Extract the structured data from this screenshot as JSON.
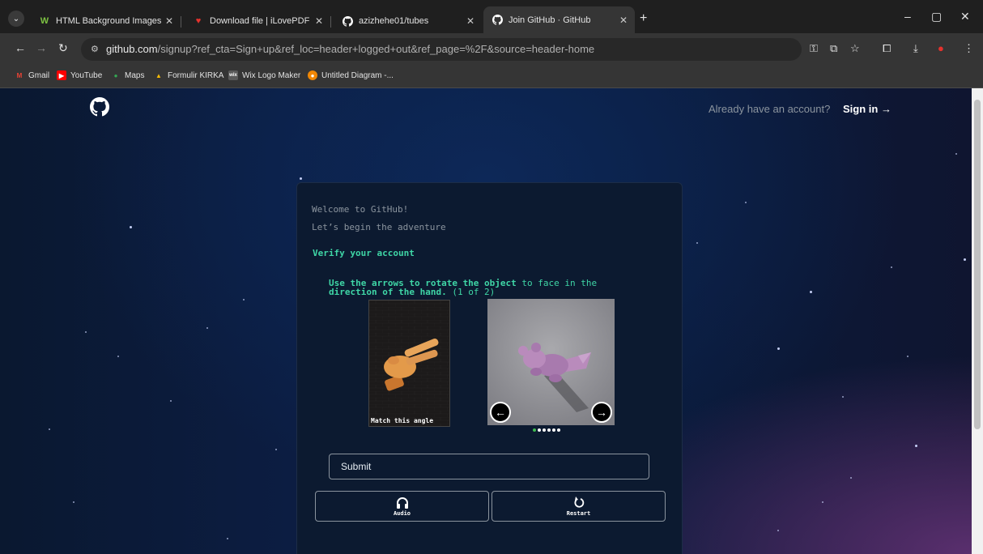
{
  "browser": {
    "tabs": [
      {
        "title": "HTML Background Images",
        "favicon": "W",
        "favicon_color": "#7dc242"
      },
      {
        "title": "Download file | iLovePDF",
        "favicon": "♥",
        "favicon_color": "#e5322d"
      },
      {
        "title": "azizhehe01/tubes",
        "favicon": "github",
        "favicon_color": "#ffffff"
      },
      {
        "title": "Join GitHub · GitHub",
        "favicon": "github",
        "favicon_color": "#ffffff",
        "active": true
      }
    ],
    "url_host": "github.com",
    "url_rest": "/signup?ref_cta=Sign+up&ref_loc=header+logged+out&ref_page=%2F&source=header-home",
    "bookmarks": [
      {
        "label": "Gmail",
        "icon": "M",
        "color": "#ea4335"
      },
      {
        "label": "YouTube",
        "icon": "▶",
        "color": "#ff0000"
      },
      {
        "label": "Maps",
        "icon": "●",
        "color": "#34a853"
      },
      {
        "label": "Formulir KIRKA",
        "icon": "▲",
        "color": "#fbbc04"
      },
      {
        "label": "Wix Logo Maker",
        "icon": "wix",
        "color": "#4a4a4a"
      },
      {
        "label": "Untitled Diagram -...",
        "icon": "●",
        "color": "#f08705"
      }
    ]
  },
  "page": {
    "signin_prompt": "Already have an account?",
    "signin_link": "Sign in →",
    "welcome_line1": "Welcome to GitHub!",
    "welcome_line2": "Let’s begin the adventure",
    "verify_heading": "Verify your account",
    "captcha": {
      "instruction_bold1": "Use the arrows to rotate the object",
      "instruction_mid": " to face in the ",
      "instruction_bold2": "direction of the hand.",
      "instruction_count": " (1 of 2)",
      "reference_label": "Match this angle",
      "dots_total": 6,
      "dots_active": 1,
      "submit_label": "Submit",
      "audio_label": "Audio",
      "restart_label": "Restart"
    }
  }
}
